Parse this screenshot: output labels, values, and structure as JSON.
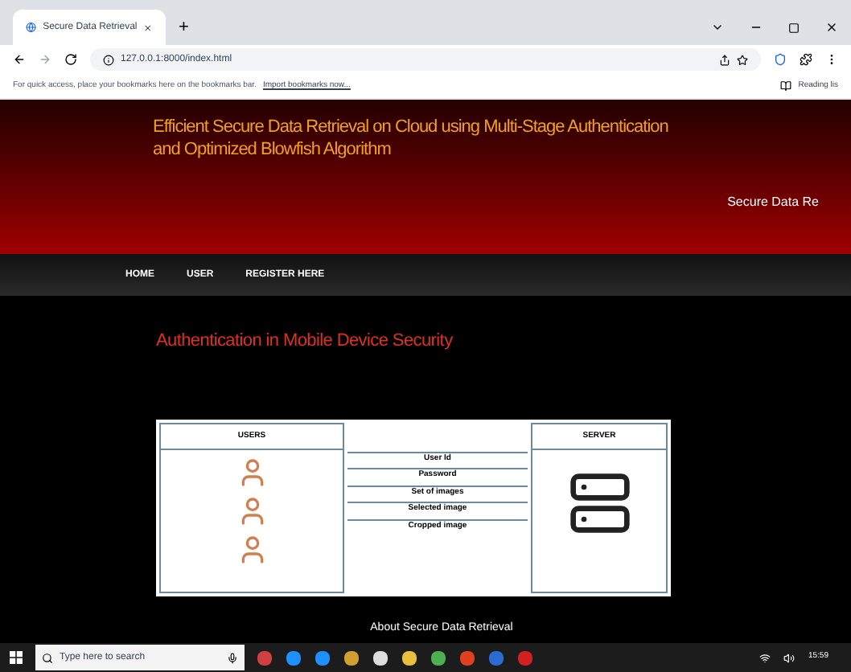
{
  "browser": {
    "tab_title": "Secure Data Retrieval",
    "new_tab": "+",
    "url": "127.0.0.1:8000/index.html",
    "bookmarks_hint": "For quick access, place your bookmarks here on the bookmarks bar.",
    "bookmarks_link": "Import bookmarks now...",
    "reading_list": "Reading lis"
  },
  "header": {
    "title": "Efficient Secure Data Retrieval on Cloud using Multi-Stage Authentication and Optimized Blowfish Algorithm",
    "subtitle": "Secure Data Re"
  },
  "nav": [
    {
      "label": "HOME",
      "selected": false
    },
    {
      "label": "USER",
      "selected": false
    },
    {
      "label": "REGISTER HERE",
      "selected": false
    }
  ],
  "section_title": "Authentication in Mobile Device Security",
  "diagram": {
    "left_title": "USERS",
    "right_title": "SERVER",
    "steps": [
      "User Id",
      "Password",
      "Set of images",
      "Selected image",
      "Cropped image"
    ]
  },
  "caption": "About Secure Data Retrieval",
  "taskbar": {
    "search_placeholder": "Type here to search",
    "time": "15:59"
  }
}
